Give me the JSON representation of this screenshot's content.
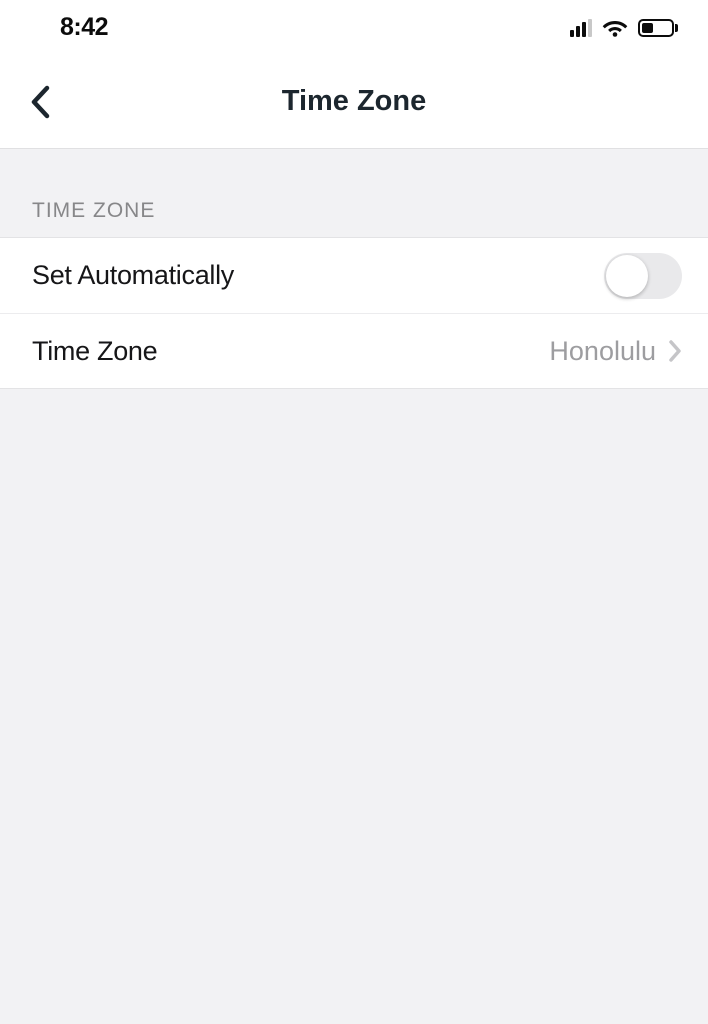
{
  "status_bar": {
    "time": "8:42"
  },
  "nav": {
    "title": "Time Zone"
  },
  "section": {
    "header": "TIME ZONE",
    "rows": {
      "set_auto": {
        "label": "Set Automatically",
        "on": false
      },
      "time_zone": {
        "label": "Time Zone",
        "value": "Honolulu"
      }
    }
  }
}
